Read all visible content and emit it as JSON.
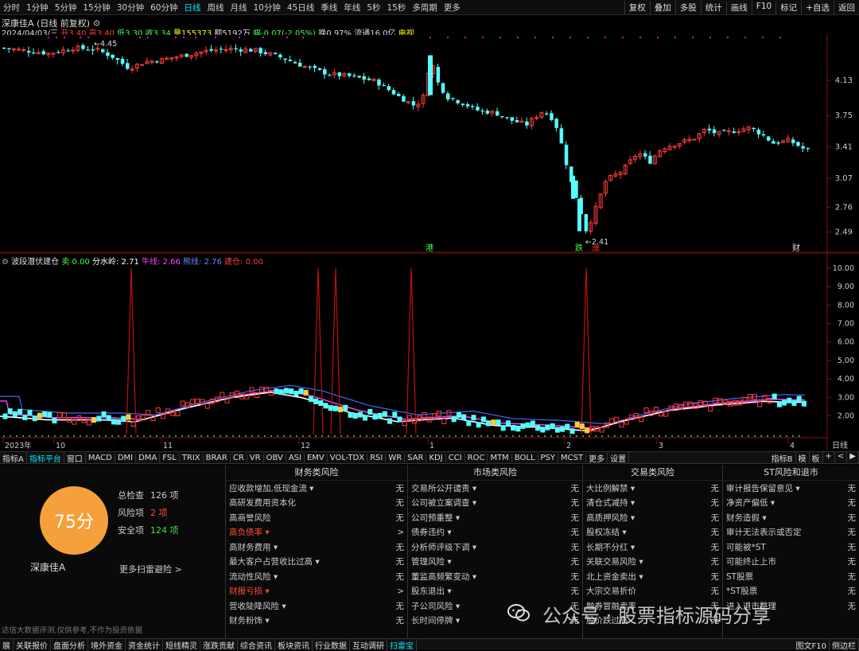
{
  "toolbar": {
    "periods": [
      "分时",
      "1分钟",
      "5分钟",
      "15分钟",
      "30分钟",
      "60分钟",
      "日线",
      "周线",
      "月线",
      "10分钟",
      "45日线",
      "季线",
      "年线",
      "5秒",
      "15秒",
      "多周期",
      "更多"
    ],
    "selected": "日线",
    "right_buttons": [
      "复权",
      "叠加",
      "多股",
      "统计",
      "画线",
      "F10",
      "标记",
      "+自选",
      "返回"
    ]
  },
  "main": {
    "title": "深康佳A (日线 前复权)",
    "date": "2024/04/03/三",
    "open": "开3.40",
    "high": "高3.40",
    "low": "低3.30",
    "close": "收3.34",
    "volume": "量155373",
    "amount": "额5192万",
    "change": "幅-0.07(-2.05%)",
    "turnover": "换0.97%",
    "float_cap": "流通16.0亿",
    "sector": "电视",
    "high_label": "4.45",
    "low_label": "2.41",
    "price_ticks": [
      "4.13",
      "3.75",
      "3.41",
      "3.07",
      "2.76",
      "2.49"
    ],
    "markers": [
      "港",
      "跌",
      "涨",
      "财"
    ],
    "colors": {
      "up": "#ff3b3b",
      "down": "#54ffff",
      "marker": "#ff00ff"
    }
  },
  "indicator": {
    "name": "波段潜伏建仓",
    "sell_label": "卖",
    "sell_value": "0.00",
    "water_label": "分水岭:",
    "water_value": "2.71",
    "bull_label": "牛线:",
    "bull_value": "2.66",
    "bear_label": "熊线:",
    "bear_value": "2.76",
    "build_label": "建仓:",
    "build_value": "0.00",
    "y_ticks": [
      "10.00",
      "9.00",
      "8.00",
      "7.00",
      "6.00",
      "5.00",
      "4.00",
      "3.00",
      "2.00"
    ],
    "x_labels": [
      "2023年",
      "10",
      "11",
      "12",
      "1",
      "2",
      "3",
      "4"
    ],
    "period_label": "日线"
  },
  "tabs": {
    "items": [
      "指标A",
      "指标平台",
      "窗口",
      "MACD",
      "DMI",
      "DMA",
      "FSL",
      "TRIX",
      "BRAR",
      "CR",
      "VR",
      "OBV",
      "ASI",
      "EMV",
      "VOL-TDX",
      "RSI",
      "WR",
      "SAR",
      "KDJ",
      "CCI",
      "ROC",
      "MTM",
      "BOLL",
      "PSY",
      "MCST",
      "更多",
      "设置"
    ],
    "selected": "指标平台",
    "right": [
      "指标B",
      "模",
      "板",
      "+",
      "<",
      "▶"
    ]
  },
  "risk": {
    "score": "75分",
    "total_label": "总检查",
    "total_value": "126 项",
    "risk_label": "风险项",
    "risk_value": "2 项",
    "safe_label": "安全项",
    "safe_value": "124 项",
    "stock": "深康佳A",
    "more": "更多扫雷避险 >",
    "disclaimer": "达信大数据评测,仅供参考,不作为投资依据",
    "columns": [
      {
        "title": "财务类风险",
        "items": [
          {
            "label": "应收款增加,低现金流 ▾",
            "status": "无"
          },
          {
            "label": "高研发费用资本化",
            "status": "无"
          },
          {
            "label": "高商誉风险",
            "status": "无"
          },
          {
            "label": "高负债率 ▾",
            "status": ">",
            "red": true
          },
          {
            "label": "高财务费用 ▾",
            "status": "无"
          },
          {
            "label": "最大客户占营收比过高 ▾",
            "status": "无"
          },
          {
            "label": "流动性风险 ▾",
            "status": "无"
          },
          {
            "label": "财报亏损 ▾",
            "status": ">",
            "red": true
          },
          {
            "label": "营收陡降风险 ▾",
            "status": "无"
          },
          {
            "label": "财务粉饰 ▾",
            "status": "无"
          }
        ]
      },
      {
        "title": "市场类风险",
        "items": [
          {
            "label": "交易所公开谴责 ▾",
            "status": "无"
          },
          {
            "label": "公司被立案调查 ▾",
            "status": "无"
          },
          {
            "label": "公司预重整 ▾",
            "status": "无"
          },
          {
            "label": "债券违约 ▾",
            "status": "无"
          },
          {
            "label": "分析师评级下调 ▾",
            "status": "无"
          },
          {
            "label": "管理风险 ▾",
            "status": "无"
          },
          {
            "label": "董监高频繁变动 ▾",
            "status": "无"
          },
          {
            "label": "股东退出 ▾",
            "status": "无"
          },
          {
            "label": "子公司风险 ▾",
            "status": "无"
          },
          {
            "label": "长时间停牌 ▾",
            "status": "无"
          }
        ]
      },
      {
        "title": "交易类风险",
        "items": [
          {
            "label": "大比例解禁 ▾",
            "status": "无"
          },
          {
            "label": "清仓式减持 ▾",
            "status": "无"
          },
          {
            "label": "高质押风险 ▾",
            "status": "无"
          },
          {
            "label": "股权冻结 ▾",
            "status": "无"
          },
          {
            "label": "长期不分红 ▾",
            "status": "无"
          },
          {
            "label": "关联交易风险 ▾",
            "status": "无"
          },
          {
            "label": "北上资金卖出 ▾",
            "status": "无"
          },
          {
            "label": "大宗交易折价",
            "status": "无"
          },
          {
            "label": "融券冒融卖率",
            "status": "无"
          },
          {
            "label": "股价跌过高",
            "status": "无"
          }
        ]
      },
      {
        "title": "ST风险和退市",
        "items": [
          {
            "label": "审计报告保留意见 ▾",
            "status": "无"
          },
          {
            "label": "净资产偏低 ▾",
            "status": "无"
          },
          {
            "label": "财务造假 ▾",
            "status": "无"
          },
          {
            "label": "审计无法表示或否定",
            "status": "无"
          },
          {
            "label": "可能被*ST",
            "status": "无"
          },
          {
            "label": "可能终止上市",
            "status": "无"
          },
          {
            "label": "ST股票",
            "status": "无"
          },
          {
            "label": "*ST股票",
            "status": "无"
          },
          {
            "label": "进入退市整理",
            "status": "无"
          },
          {
            "label": "",
            "status": ""
          }
        ]
      }
    ]
  },
  "bottom": {
    "items": [
      "展",
      "关联报价",
      "盘面分析",
      "境外资金",
      "资金统计",
      "短线精灵",
      "涨跌贡献",
      "综合资讯",
      "板块资讯",
      "行业数据",
      "互动调研",
      "扫雷宝"
    ],
    "highlight": "扫雷宝",
    "right": [
      "图文F10",
      "侧边栏"
    ]
  },
  "watermark": "公众号 · 股票指标源码分享"
}
